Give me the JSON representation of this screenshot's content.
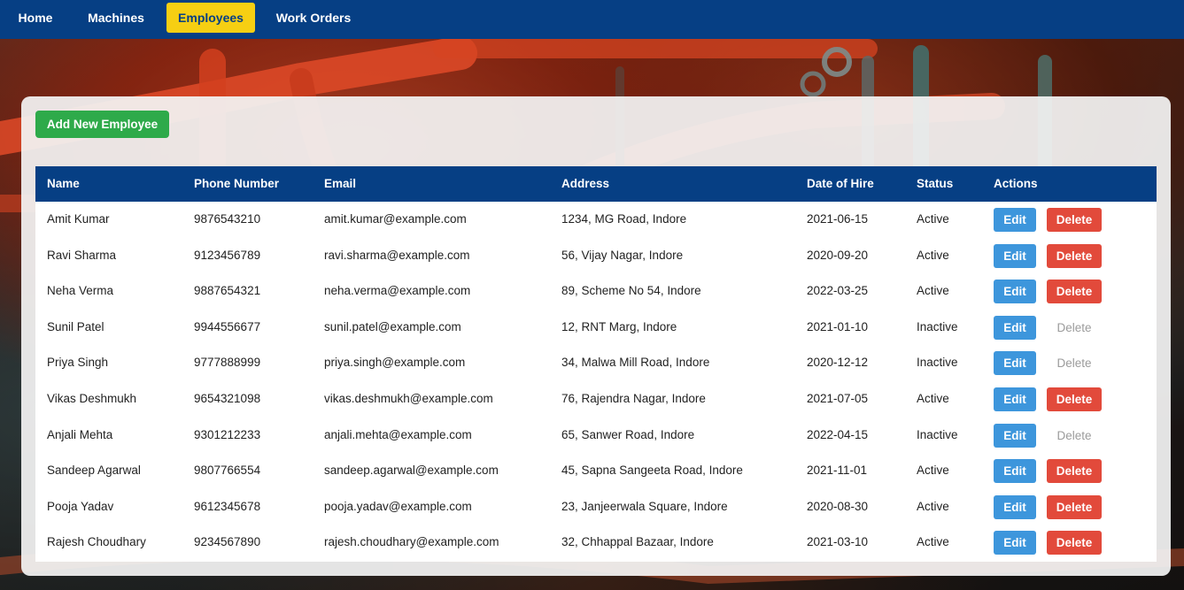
{
  "nav": {
    "items": [
      {
        "label": "Home",
        "active": false
      },
      {
        "label": "Machines",
        "active": false
      },
      {
        "label": "Employees",
        "active": true
      },
      {
        "label": "Work Orders",
        "active": false
      }
    ]
  },
  "toolbar": {
    "add_label": "Add New Employee"
  },
  "table": {
    "headers": [
      "Name",
      "Phone Number",
      "Email",
      "Address",
      "Date of Hire",
      "Status",
      "Actions"
    ],
    "edit_label": "Edit",
    "delete_label": "Delete",
    "rows": [
      {
        "name": "Amit Kumar",
        "phone": "9876543210",
        "email": "amit.kumar@example.com",
        "address": "1234, MG Road, Indore",
        "hire_date": "2021-06-15",
        "status": "Active",
        "delete_enabled": true
      },
      {
        "name": "Ravi Sharma",
        "phone": "9123456789",
        "email": "ravi.sharma@example.com",
        "address": "56, Vijay Nagar, Indore",
        "hire_date": "2020-09-20",
        "status": "Active",
        "delete_enabled": true
      },
      {
        "name": "Neha Verma",
        "phone": "9887654321",
        "email": "neha.verma@example.com",
        "address": "89, Scheme No 54, Indore",
        "hire_date": "2022-03-25",
        "status": "Active",
        "delete_enabled": true
      },
      {
        "name": "Sunil Patel",
        "phone": "9944556677",
        "email": "sunil.patel@example.com",
        "address": "12, RNT Marg, Indore",
        "hire_date": "2021-01-10",
        "status": "Inactive",
        "delete_enabled": false
      },
      {
        "name": "Priya Singh",
        "phone": "9777888999",
        "email": "priya.singh@example.com",
        "address": "34, Malwa Mill Road, Indore",
        "hire_date": "2020-12-12",
        "status": "Inactive",
        "delete_enabled": false
      },
      {
        "name": "Vikas Deshmukh",
        "phone": "9654321098",
        "email": "vikas.deshmukh@example.com",
        "address": "76, Rajendra Nagar, Indore",
        "hire_date": "2021-07-05",
        "status": "Active",
        "delete_enabled": true
      },
      {
        "name": "Anjali Mehta",
        "phone": "9301212233",
        "email": "anjali.mehta@example.com",
        "address": "65, Sanwer Road, Indore",
        "hire_date": "2022-04-15",
        "status": "Inactive",
        "delete_enabled": false
      },
      {
        "name": "Sandeep Agarwal",
        "phone": "9807766554",
        "email": "sandeep.agarwal@example.com",
        "address": "45, Sapna Sangeeta Road, Indore",
        "hire_date": "2021-11-01",
        "status": "Active",
        "delete_enabled": true
      },
      {
        "name": "Pooja Yadav",
        "phone": "9612345678",
        "email": "pooja.yadav@example.com",
        "address": "23, Janjeerwala Square, Indore",
        "hire_date": "2020-08-30",
        "status": "Active",
        "delete_enabled": true
      },
      {
        "name": "Rajesh Choudhary",
        "phone": "9234567890",
        "email": "rajesh.choudhary@example.com",
        "address": "32, Chhappal Bazaar, Indore",
        "hire_date": "2021-03-10",
        "status": "Active",
        "delete_enabled": true
      }
    ]
  },
  "colors": {
    "nav_bg": "#063f84",
    "nav_active_bg": "#f6cf13",
    "add_button": "#2eaa4a",
    "edit_button": "#3d96dc",
    "delete_button": "#e24a3b",
    "delete_disabled_text": "#9b9b9b"
  }
}
